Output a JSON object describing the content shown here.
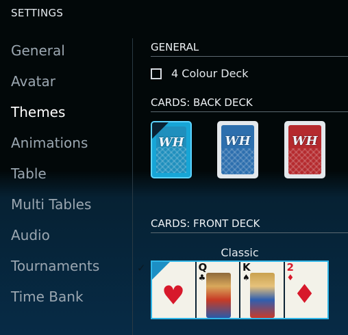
{
  "header": {
    "title": "SETTINGS"
  },
  "sidebar": {
    "items": [
      {
        "label": "General"
      },
      {
        "label": "Avatar"
      },
      {
        "label": "Themes"
      },
      {
        "label": "Animations"
      },
      {
        "label": "Table"
      },
      {
        "label": "Multi Tables"
      },
      {
        "label": "Audio"
      },
      {
        "label": "Tournaments"
      },
      {
        "label": "Time Bank"
      }
    ],
    "active": "Themes"
  },
  "general": {
    "heading": "GENERAL",
    "four_colour_label": "4 Colour Deck",
    "four_colour_checked": false
  },
  "back_deck": {
    "heading": "CARDS: BACK DECK",
    "logo_text": "WH",
    "cards": [
      {
        "color": "#17a5d6",
        "selected": true
      },
      {
        "color": "#2d6fae",
        "selected": false
      },
      {
        "color": "#b52a2e",
        "selected": false
      }
    ],
    "check_icon": "✓"
  },
  "front_deck": {
    "heading": "CARDS: FRONT DECK",
    "option_label": "Classic",
    "selected": true,
    "cards": [
      {
        "rank": "",
        "suit": "♥",
        "color": "#d7192b"
      },
      {
        "rank": "Q",
        "suit": "♣",
        "color": "#111111"
      },
      {
        "rank": "K",
        "suit": "♠",
        "color": "#111111"
      },
      {
        "rank": "2",
        "suit": "♦",
        "color": "#d7192b"
      }
    ]
  }
}
